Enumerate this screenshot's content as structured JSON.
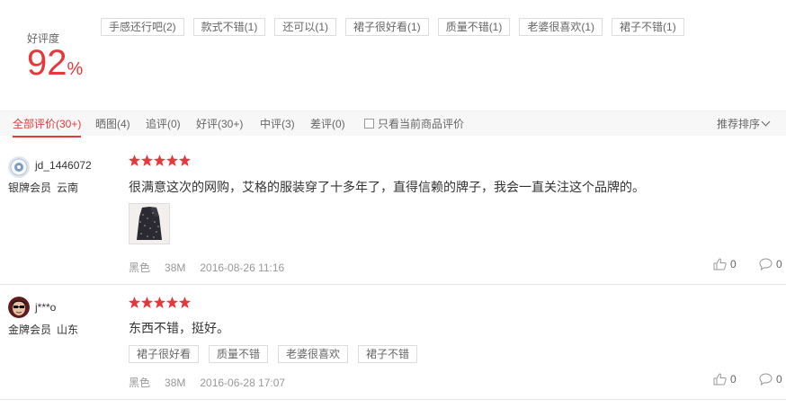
{
  "rating": {
    "label": "好评度",
    "value": "92",
    "unit": "%"
  },
  "hot_tags": [
    "手感还行吧(2)",
    "款式不错(1)",
    "还可以(1)",
    "裙子很好看(1)",
    "质量不错(1)",
    "老婆很喜欢(1)",
    "裙子不错(1)"
  ],
  "filters": {
    "all": "全部评价(30+)",
    "images": "晒图(4)",
    "followup": "追评(0)",
    "good": "好评(30+)",
    "neutral": "中评(3)",
    "bad": "差评(0)",
    "current_only": "只看当前商品评价",
    "sort": "推荐排序"
  },
  "reviews": [
    {
      "user": "jd_1446072",
      "level": "银牌会员",
      "region": "云南",
      "stars": 5,
      "content": "很满意这次的网购，艾格的服装穿了十多年了，直得信赖的牌子，我会一直关注这个品牌的。",
      "color": "黑色",
      "size": "38M",
      "date": "2016-08-26 11:16",
      "likes": "0",
      "comments": "0"
    },
    {
      "user": "j***o",
      "level": "金牌会员",
      "region": "山东",
      "stars": 5,
      "content": "东西不错，挺好。",
      "tags": [
        "裙子很好看",
        "质量不错",
        "老婆很喜欢",
        "裙子不错"
      ],
      "color": "黑色",
      "size": "38M",
      "date": "2016-06-28 17:07",
      "likes": "0",
      "comments": "0"
    }
  ],
  "colors": {
    "accent": "#e4393c",
    "muted": "#999999",
    "border": "#dddddd"
  }
}
